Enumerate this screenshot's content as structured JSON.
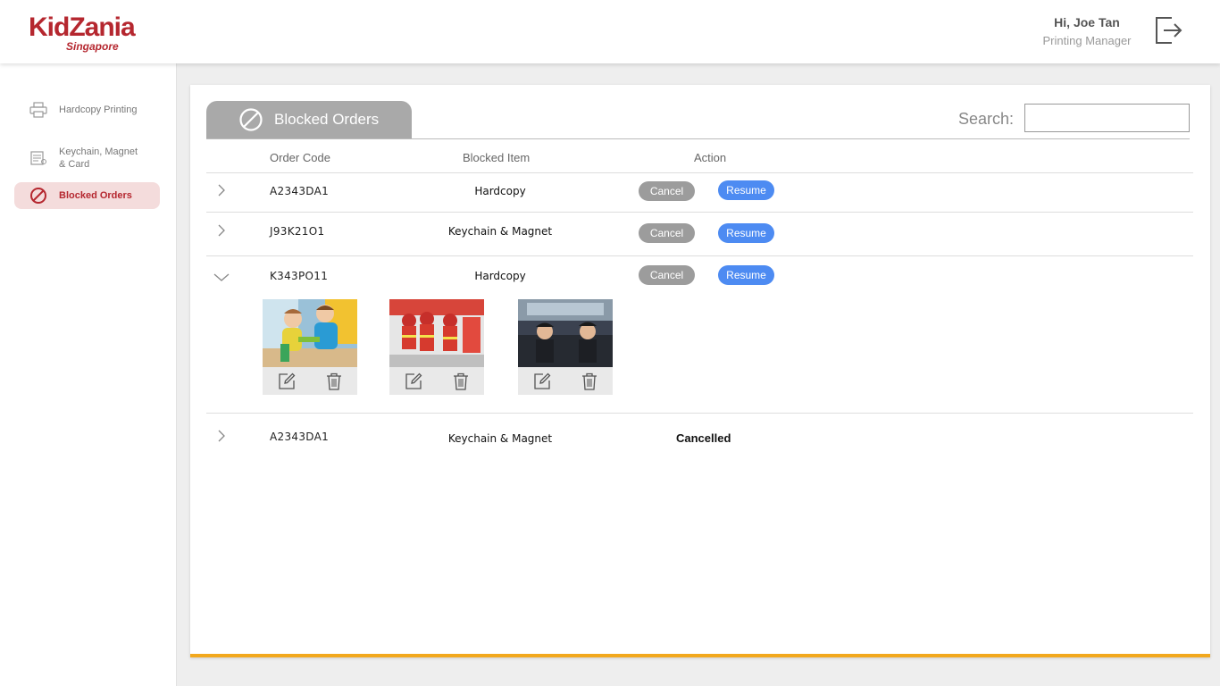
{
  "header": {
    "logo_text": "KidZania",
    "logo_sub": "Singapore",
    "greeting": "Hi, Joe Tan",
    "role": "Printing Manager",
    "logout_icon": "logout-icon"
  },
  "sidebar": {
    "items": [
      {
        "label": "Hardcopy Printing",
        "icon": "printer-icon",
        "active": false
      },
      {
        "label": "Keychain, Magnet & Card",
        "icon": "keychain-icon",
        "active": false
      },
      {
        "label": "Blocked Orders",
        "icon": "block-icon",
        "active": true
      }
    ]
  },
  "main": {
    "tab_label": "Blocked Orders",
    "search_label": "Search:",
    "search_value": "",
    "columns": [
      "Order Code",
      "Blocked Item",
      "Action"
    ],
    "rows": [
      {
        "code": "A2343DA1",
        "item": "Hardcopy",
        "cancel": "Cancel",
        "resume": "Resume",
        "expanded": false
      },
      {
        "code": "J93K21O1",
        "item": "Keychain & Magnet",
        "cancel": "Cancel",
        "resume": "Resume",
        "expanded": false
      },
      {
        "code": "K343PO11",
        "item": "Hardcopy",
        "cancel": "Cancel",
        "resume": "Resume",
        "expanded": true,
        "photos": [
          {
            "subject": "kids-playing-photo"
          },
          {
            "subject": "kids-firefighters-photo"
          },
          {
            "subject": "kids-pilots-photo"
          }
        ]
      },
      {
        "code": "A2343DA1",
        "item": "Keychain & Magnet",
        "status": "Cancelled",
        "expanded": false
      }
    ]
  },
  "colors": {
    "brand": "#b5272f",
    "accent_bar": "#f2a81d",
    "resume": "#4d8bf2",
    "cancel": "#9c9c9c",
    "tab": "#a9a9a9"
  }
}
